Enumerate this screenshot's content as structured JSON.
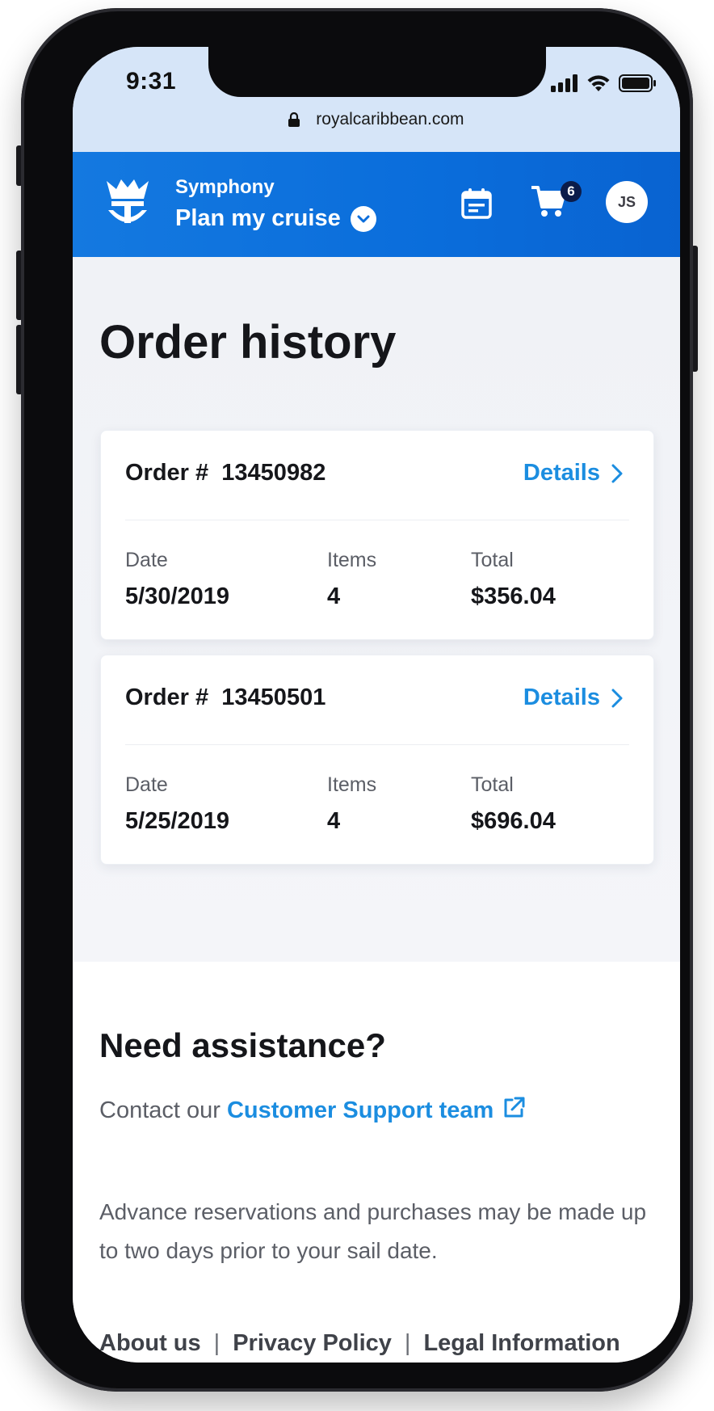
{
  "status_bar": {
    "time": "9:31",
    "url": "royalcaribbean.com"
  },
  "header": {
    "ship_name": "Symphony",
    "menu_label": "Plan my cruise",
    "cart_count": "6",
    "user_initials": "JS",
    "brand_color": "#0a6ddb"
  },
  "page": {
    "title": "Order history"
  },
  "orders": [
    {
      "prefix": "Order #",
      "number": "13450982",
      "details_label": "Details",
      "date_label": "Date",
      "date": "5/30/2019",
      "items_label": "Items",
      "items": "4",
      "total_label": "Total",
      "total": "$356.04"
    },
    {
      "prefix": "Order #",
      "number": "13450501",
      "details_label": "Details",
      "date_label": "Date",
      "date": "5/25/2019",
      "items_label": "Items",
      "items": "4",
      "total_label": "Total",
      "total": "$696.04"
    }
  ],
  "assistance": {
    "title": "Need assistance?",
    "contact_prefix": "Contact our",
    "contact_link": "Customer Support team",
    "note": "Advance reservations and purchases may be made up to two days prior to your sail date."
  },
  "footer": {
    "links": [
      "About us",
      "Privacy Policy",
      "Legal Information"
    ],
    "separator": "|"
  },
  "icons": {
    "logo": "crown-anchor-logo-icon",
    "menu_chevron": "chevron-down-icon",
    "calendar": "calendar-icon",
    "cart": "cart-icon",
    "details_chevron": "chevron-right-icon",
    "external": "external-link-icon",
    "lock": "lock-icon"
  },
  "link_color": "#1b8de0"
}
